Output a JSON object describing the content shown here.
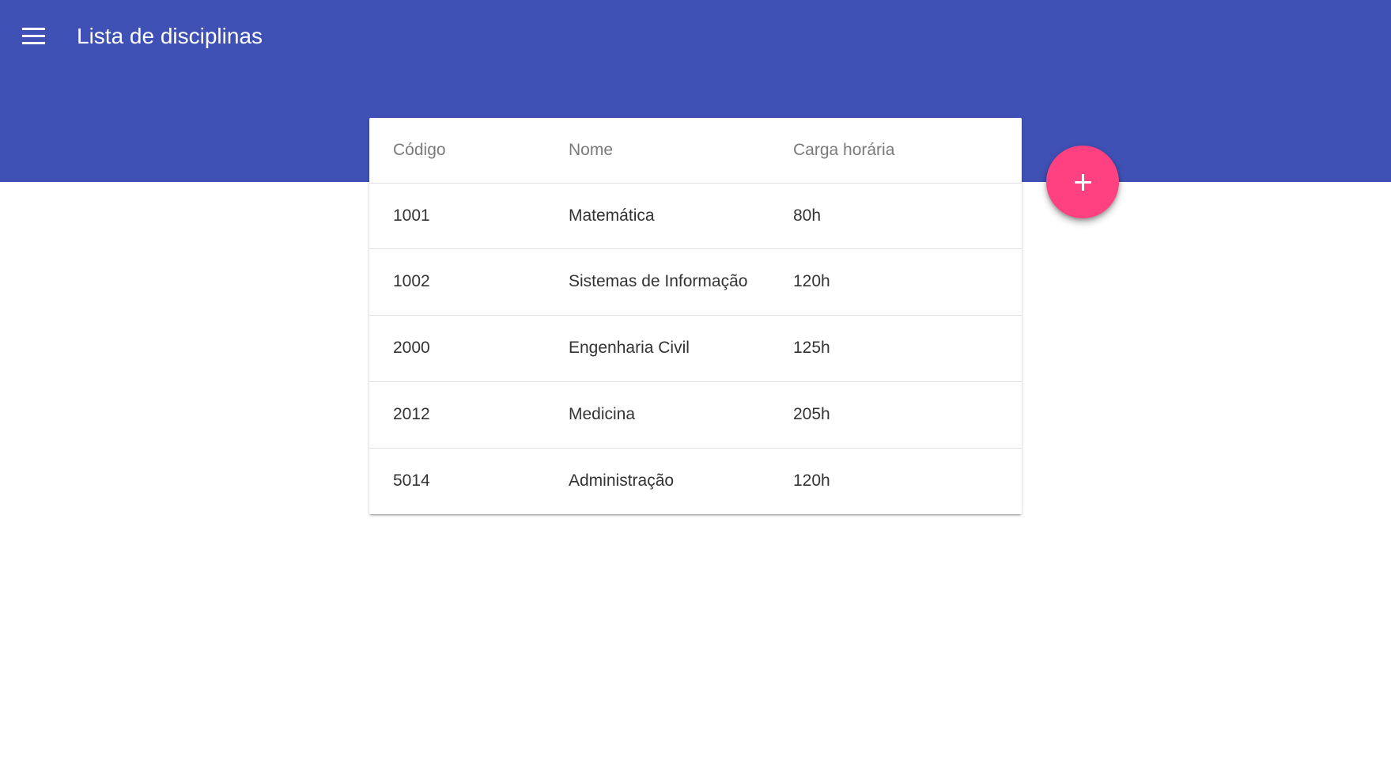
{
  "app_bar": {
    "title": "Lista de disciplinas",
    "menu_icon": "menu-icon",
    "color": "#3f51b5"
  },
  "table": {
    "headers": {
      "code": "Código",
      "name": "Nome",
      "load": "Carga horária"
    },
    "rows": [
      {
        "code": "1001",
        "name": "Matemática",
        "load": "80h"
      },
      {
        "code": "1002",
        "name": "Sistemas de Informação",
        "load": "120h"
      },
      {
        "code": "2000",
        "name": "Engenharia Civil",
        "load": "125h"
      },
      {
        "code": "2012",
        "name": "Medicina",
        "load": "205h"
      },
      {
        "code": "5014",
        "name": "Administração",
        "load": "120h"
      }
    ]
  },
  "fab": {
    "icon": "plus-icon",
    "color": "#ff4081"
  }
}
